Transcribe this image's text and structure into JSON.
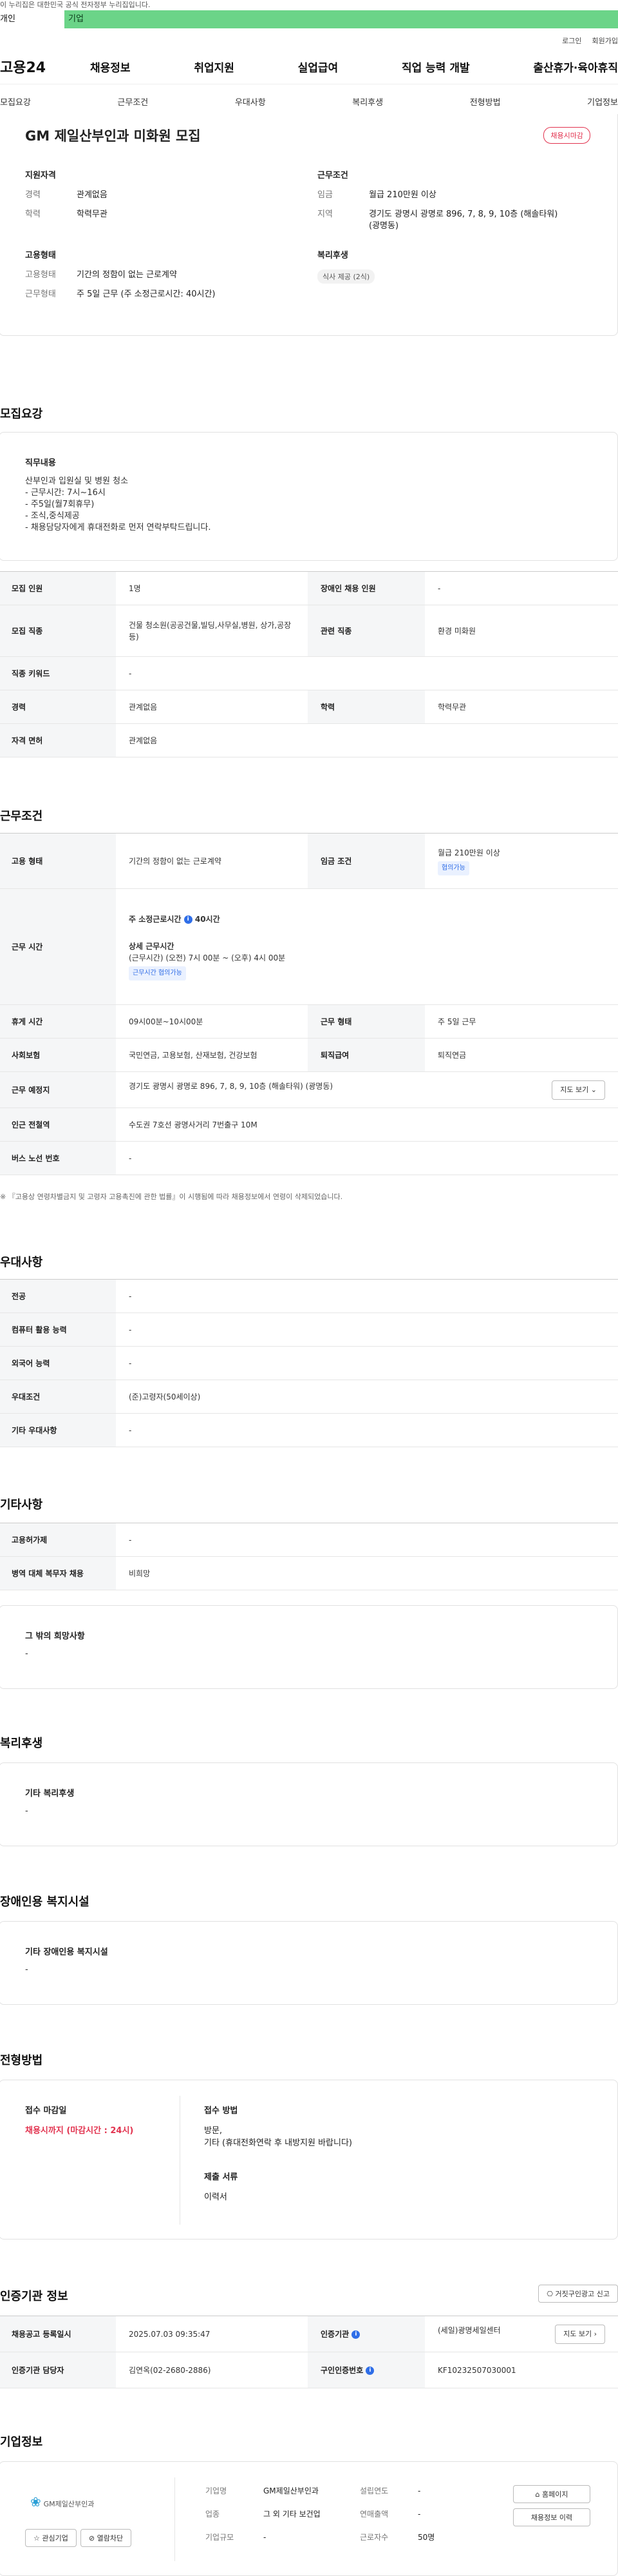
{
  "gov_banner": "이 누리집은 대한민국 공식 전자정부 누리집입니다.",
  "tabs": [
    "개인",
    "기업"
  ],
  "util": [
    "로그인",
    "회원가입"
  ],
  "logo": "고용24",
  "gnb": [
    "채용정보",
    "취업지원",
    "실업급여",
    "직업 능력 개발",
    "출산휴가·육아휴직"
  ],
  "subtabs": [
    "모집요강",
    "근무조건",
    "우대사항",
    "복리후생",
    "전형방법",
    "기업정보"
  ],
  "summary": {
    "title": "GM 제일산부인과 미화원 모집",
    "badge": "채용시마감",
    "qual_title": "지원자격",
    "qual": [
      {
        "k": "경력",
        "v": "관계없음"
      },
      {
        "k": "학력",
        "v": "학력무관"
      }
    ],
    "cond_title": "근무조건",
    "cond": [
      {
        "k": "임금",
        "v": "월급 210만원 이상"
      },
      {
        "k": "지역",
        "v": "경기도 광명시 광명로 896, 7, 8, 9, 10층 (해솔타워) (광명동)"
      }
    ],
    "emp_title": "고용형태",
    "emp": [
      {
        "k": "고용형태",
        "v": "기간의 정함이 없는 근로계약"
      },
      {
        "k": "근무형태",
        "v": "주 5일 근무 (주 소정근로시간: 40시간)"
      }
    ],
    "welfare_title": "복리후생",
    "welfare_chip": "식사 제공 (2식)"
  },
  "recruit": {
    "title": "모집요강",
    "job_title": "직무내용",
    "job_lines": [
      "산부인과 입원실 및 병원 청소",
      "- 근무시간: 7시~16시",
      "- 주5일(월7회휴무)",
      "- 조식,중식제공",
      "- 채용담당자에게 휴대전화로 먼저 연락부탁드립니다."
    ],
    "rows": {
      "headcount_k": "모집 인원",
      "headcount_v": "1명",
      "disabled_k": "장애인 채용 인원",
      "disabled_v": "-",
      "jobtype_k": "모집 직종",
      "jobtype_v": "건물 청소원(공공건물,빌딩,사무실,병원, 상가,공장 등)",
      "related_k": "관련 직종",
      "related_v": "환경 미화원",
      "keyword_k": "직종 키워드",
      "keyword_v": "-",
      "career_k": "경력",
      "career_v": "관계없음",
      "edu_k": "학력",
      "edu_v": "학력무관",
      "license_k": "자격 면허",
      "license_v": "관계없음"
    }
  },
  "work": {
    "title": "근무조건",
    "emp_k": "고용 형태",
    "emp_v": "기간의 정함이 없는 근로계약",
    "wage_k": "임금 조건",
    "wage_v": "월급 210만원 이상",
    "wage_tag": "협의가능",
    "hours_k": "근무 시간",
    "hours_week_label": "주 소정근로시간",
    "hours_week_value": "40시간",
    "hours_detail_label": "상세 근무시간",
    "hours_detail_value": "(근무시간) (오전) 7시 00분 ~ (오후) 4시 00분",
    "hours_tag": "근무시간 협의가능",
    "break_k": "휴게 시간",
    "break_v": "09시00분~10시00분",
    "workform_k": "근무 형태",
    "workform_v": "주 5일 근무",
    "insurance_k": "사회보험",
    "insurance_v": "국민연금, 고용보험, 산재보험, 건강보험",
    "severance_k": "퇴직급여",
    "severance_v": "퇴직연금",
    "place_k": "근무 예정지",
    "place_v": "경기도 광명시 광명로 896, 7, 8, 9, 10층 (해솔타워) (광명동)",
    "map_btn": "지도 보기",
    "subway_k": "인근 전철역",
    "subway_v": "수도권 7호선 광명사거리 7번출구 10M",
    "bus_k": "버스 노선 번호",
    "bus_v": "-",
    "note": "※ 『고용상 연령차별금지 및 고령자 고용촉진에 관한 법률』이 시행됨에 따라 채용정보에서 연령이 삭제되었습니다."
  },
  "pref": {
    "title": "우대사항",
    "rows": [
      {
        "k": "전공",
        "v": "-"
      },
      {
        "k": "컴퓨터 활용 능력",
        "v": "-"
      },
      {
        "k": "외국어 능력",
        "v": "-"
      },
      {
        "k": "우대조건",
        "v": "(준)고령자(50세이상)"
      },
      {
        "k": "기타 우대사항",
        "v": "-"
      }
    ]
  },
  "etc": {
    "title": "기타사항",
    "rows": [
      {
        "k": "고용허가제",
        "v": "-"
      },
      {
        "k": "병역 대체 복무자 채용",
        "v": "비희망"
      }
    ],
    "other_title": "그 밖의 희망사항",
    "other_v": "-"
  },
  "welfare": {
    "title": "복리후생",
    "box_title": "기타 복리후생",
    "box_v": "-"
  },
  "disabled": {
    "title": "장애인용 복지시설",
    "box_title": "기타 장애인용 복지시설",
    "box_v": "-"
  },
  "selection": {
    "title": "전형방법",
    "deadline_title": "접수 마감일",
    "deadline_v": "채용시까지 (마감시간 : 24시)",
    "method_title": "접수 방법",
    "method_v1": "방문,",
    "method_v2": "기타 (휴대전화연락 후 내방지원 바랍니다)",
    "docs_title": "제출 서류",
    "docs_v": "이력서"
  },
  "cert": {
    "title": "인증기관 정보",
    "report_btn": "거짓구인광고 신고",
    "reg_k": "채용공고 등록일시",
    "reg_v": "2025.07.03 09:35:47",
    "org_k": "인증기관",
    "org_v": "(세일)광명세일센터",
    "view_btn": "지도 보기",
    "manager_k": "인증기관 담당자",
    "manager_v": "김연옥(02-2680-2886)",
    "id_k": "구인인증번호",
    "id_v": "KF10232507030001"
  },
  "company": {
    "title": "기업정보",
    "logo_text": "GM제일산부인과",
    "fav_btn": "관심기업",
    "block_btn": "열람차단",
    "name_k": "기업명",
    "name_v": "GM제일산부인과",
    "founded_k": "설립연도",
    "founded_v": "-",
    "industry_k": "업종",
    "industry_v": "그 외 기타 보건업",
    "sales_k": "연매출액",
    "sales_v": "-",
    "size_k": "기업규모",
    "size_v": "-",
    "employees_k": "근로자수",
    "employees_v": "50명",
    "homepage_btn": "홈페이지",
    "history_btn": "채용정보 이력"
  }
}
